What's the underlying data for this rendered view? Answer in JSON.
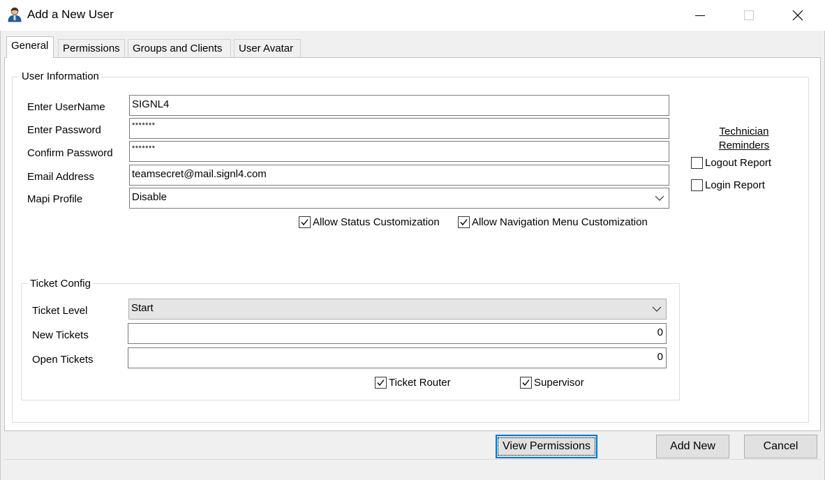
{
  "window": {
    "title": "Add a New User",
    "icon": "user-avatar-icon"
  },
  "tabs": [
    {
      "label": "General",
      "active": true
    },
    {
      "label": "Permissions",
      "active": false
    },
    {
      "label": "Groups and Clients",
      "active": false
    },
    {
      "label": "User Avatar",
      "active": false
    }
  ],
  "user_info": {
    "legend": "User Information",
    "username_label": "Enter UserName",
    "username_value": "SIGNL4",
    "password_label": "Enter Password",
    "password_value": "*******",
    "confirm_label": "Confirm Password",
    "confirm_value": "*******",
    "email_label": "Email Address",
    "email_value": "teamsecret@mail.signl4.com",
    "mapi_label": "Mapi Profile",
    "mapi_value": "Disable",
    "allow_status_label": "Allow Status Customization",
    "allow_status_checked": true,
    "allow_nav_label": "Allow Navigation Menu Customization",
    "allow_nav_checked": true
  },
  "reminders": {
    "heading_line1": "Technician",
    "heading_line2": "Reminders",
    "logout_label": "Logout Report",
    "logout_checked": false,
    "login_label": "Login Report",
    "login_checked": false
  },
  "ticket_config": {
    "legend": "Ticket Config",
    "level_label": "Ticket Level",
    "level_value": "Start",
    "new_label": "New Tickets",
    "new_value": "0",
    "open_label": "Open Tickets",
    "open_value": "0",
    "router_label": "Ticket Router",
    "router_checked": true,
    "supervisor_label": "Supervisor",
    "supervisor_checked": true
  },
  "buttons": {
    "view_permissions": "View Permissions",
    "add_new": "Add New",
    "cancel": "Cancel"
  }
}
